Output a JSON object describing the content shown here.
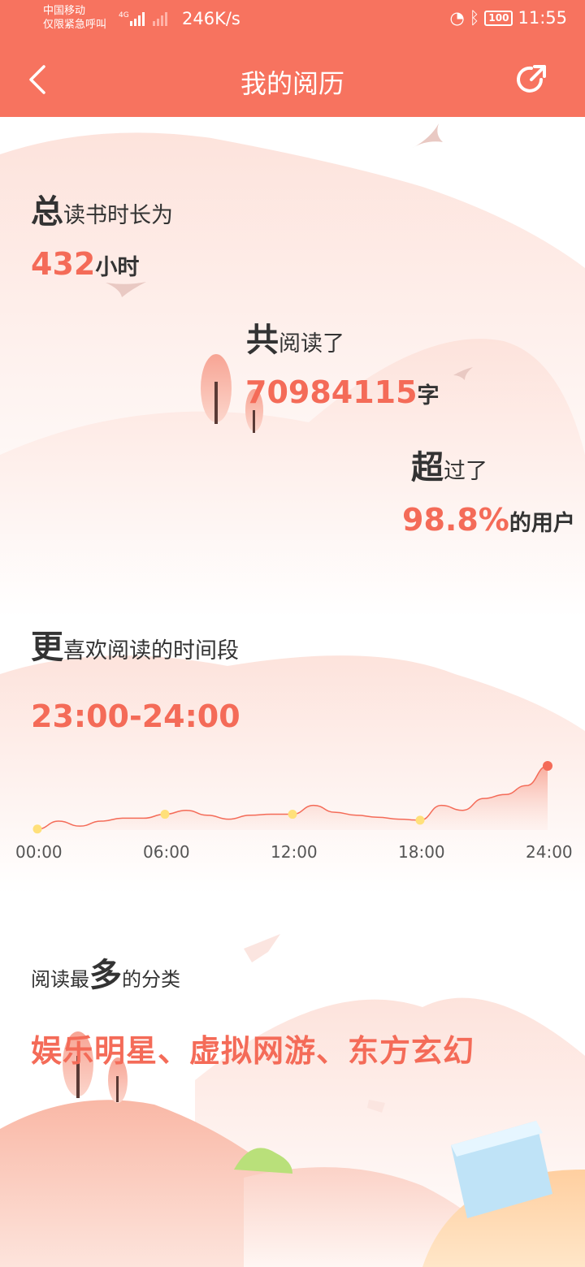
{
  "status_bar": {
    "carrier_line1": "中国移动",
    "carrier_line2": "仅限紧急呼叫",
    "network": "4G",
    "speed": "246K/s",
    "battery": "100",
    "time": "11:55"
  },
  "header": {
    "title": "我的阅历"
  },
  "stats": {
    "total_time": {
      "lead": "总",
      "rest": "读书时长为",
      "value": "432",
      "unit": "小时"
    },
    "total_words": {
      "lead": "共",
      "rest": "阅读了",
      "value": "70984115",
      "unit": "字"
    },
    "rank": {
      "lead": "超",
      "rest": "过了",
      "value": "98.8%",
      "unit": "的用户"
    }
  },
  "favorite_time": {
    "lead": "更",
    "rest": "喜欢阅读的时间段",
    "value": "23:00-24:00"
  },
  "chart_data": {
    "type": "area",
    "x_ticks": [
      "00:00",
      "06:00",
      "12:00",
      "18:00",
      "24:00"
    ],
    "x": [
      0,
      1,
      2,
      3,
      4,
      5,
      6,
      7,
      8,
      9,
      10,
      11,
      12,
      13,
      14,
      15,
      16,
      17,
      18,
      19,
      20,
      21,
      22,
      23,
      24
    ],
    "values": [
      0.1,
      0.9,
      0.4,
      0.9,
      1.2,
      1.2,
      1.6,
      2.0,
      1.5,
      1.1,
      1.5,
      1.6,
      1.6,
      2.5,
      1.8,
      1.5,
      1.3,
      1.1,
      1.0,
      2.5,
      2.0,
      3.2,
      3.6,
      4.5,
      6.5
    ],
    "highlight_point": 24,
    "grid": false,
    "accent": "#f46b58",
    "marker": "#ffe07a"
  },
  "categories_section": {
    "prefix": "阅读最",
    "emphasis": "多",
    "suffix": "的分类",
    "value": "娱乐明星、虚拟网游、东方玄幻"
  },
  "colors": {
    "brand": "#f7735f",
    "accent": "#f46b58"
  }
}
